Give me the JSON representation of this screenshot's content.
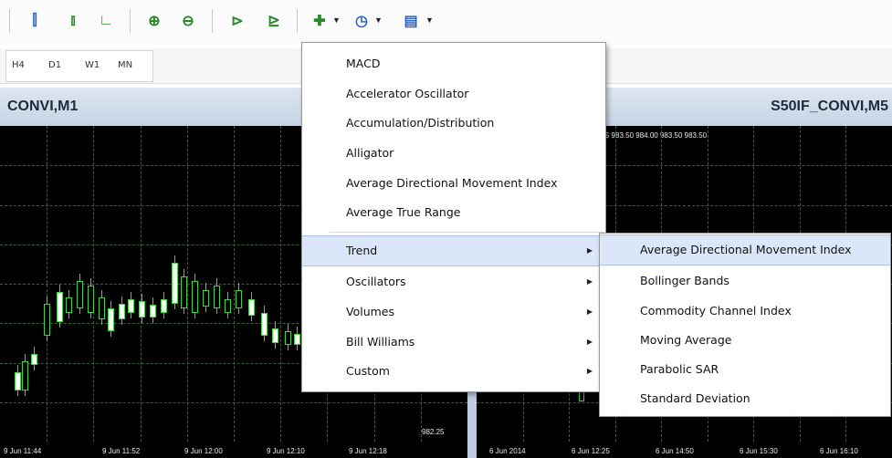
{
  "toolbar": {
    "icons": [
      {
        "name": "bar-chart-icon",
        "glyph": "⫿",
        "color": "blue"
      },
      {
        "name": "candlestick-chart-icon",
        "glyph": "⫾",
        "color": "green"
      },
      {
        "name": "line-chart-icon",
        "glyph": "∟",
        "color": "green"
      },
      {
        "name": "zoom-in-icon",
        "glyph": "⊕",
        "color": "green"
      },
      {
        "name": "zoom-out-icon",
        "glyph": "⊖",
        "color": "green"
      },
      {
        "name": "auto-scroll-icon",
        "glyph": "⊳",
        "color": "green"
      },
      {
        "name": "chart-shift-icon",
        "glyph": "⊵",
        "color": "green"
      },
      {
        "name": "indicators-icon",
        "glyph": "✚",
        "color": "green"
      },
      {
        "name": "periods-icon",
        "glyph": "◷",
        "color": "blue"
      },
      {
        "name": "templates-icon",
        "glyph": "▤",
        "color": "blue"
      }
    ]
  },
  "timeframes": [
    "H4",
    "D1",
    "W1",
    "MN"
  ],
  "chart_left": {
    "title": "CONVI,M1",
    "xticks": [
      "9 Jun 11:44",
      "9 Jun 11:52",
      "9 Jun 12:00",
      "9 Jun 12:10",
      "9 Jun 12:18"
    ],
    "price_label": "982.25"
  },
  "chart_right": {
    "title": "S50IF_CONVI,M5",
    "header": "S 983.50 984.00 983.50 983.50",
    "xticks": [
      "6 Jun 2014",
      "6 Jun 12:25",
      "6 Jun 14:50",
      "6 Jun 15:30",
      "6 Jun 16:10"
    ]
  },
  "indicators_menu": {
    "items": [
      "MACD",
      "Accelerator Oscillator",
      "Accumulation/Distribution",
      "Alligator",
      "Average Directional Movement Index",
      "Average True Range"
    ],
    "submenus": [
      "Trend",
      "Oscillators",
      "Volumes",
      "Bill Williams",
      "Custom"
    ],
    "selected": "Trend"
  },
  "trend_submenu": {
    "items": [
      "Average Directional Movement Index",
      "Bollinger Bands",
      "Commodity Channel Index",
      "Moving Average",
      "Parabolic SAR",
      "Standard Deviation"
    ],
    "selected": "Average Directional Movement Index"
  }
}
